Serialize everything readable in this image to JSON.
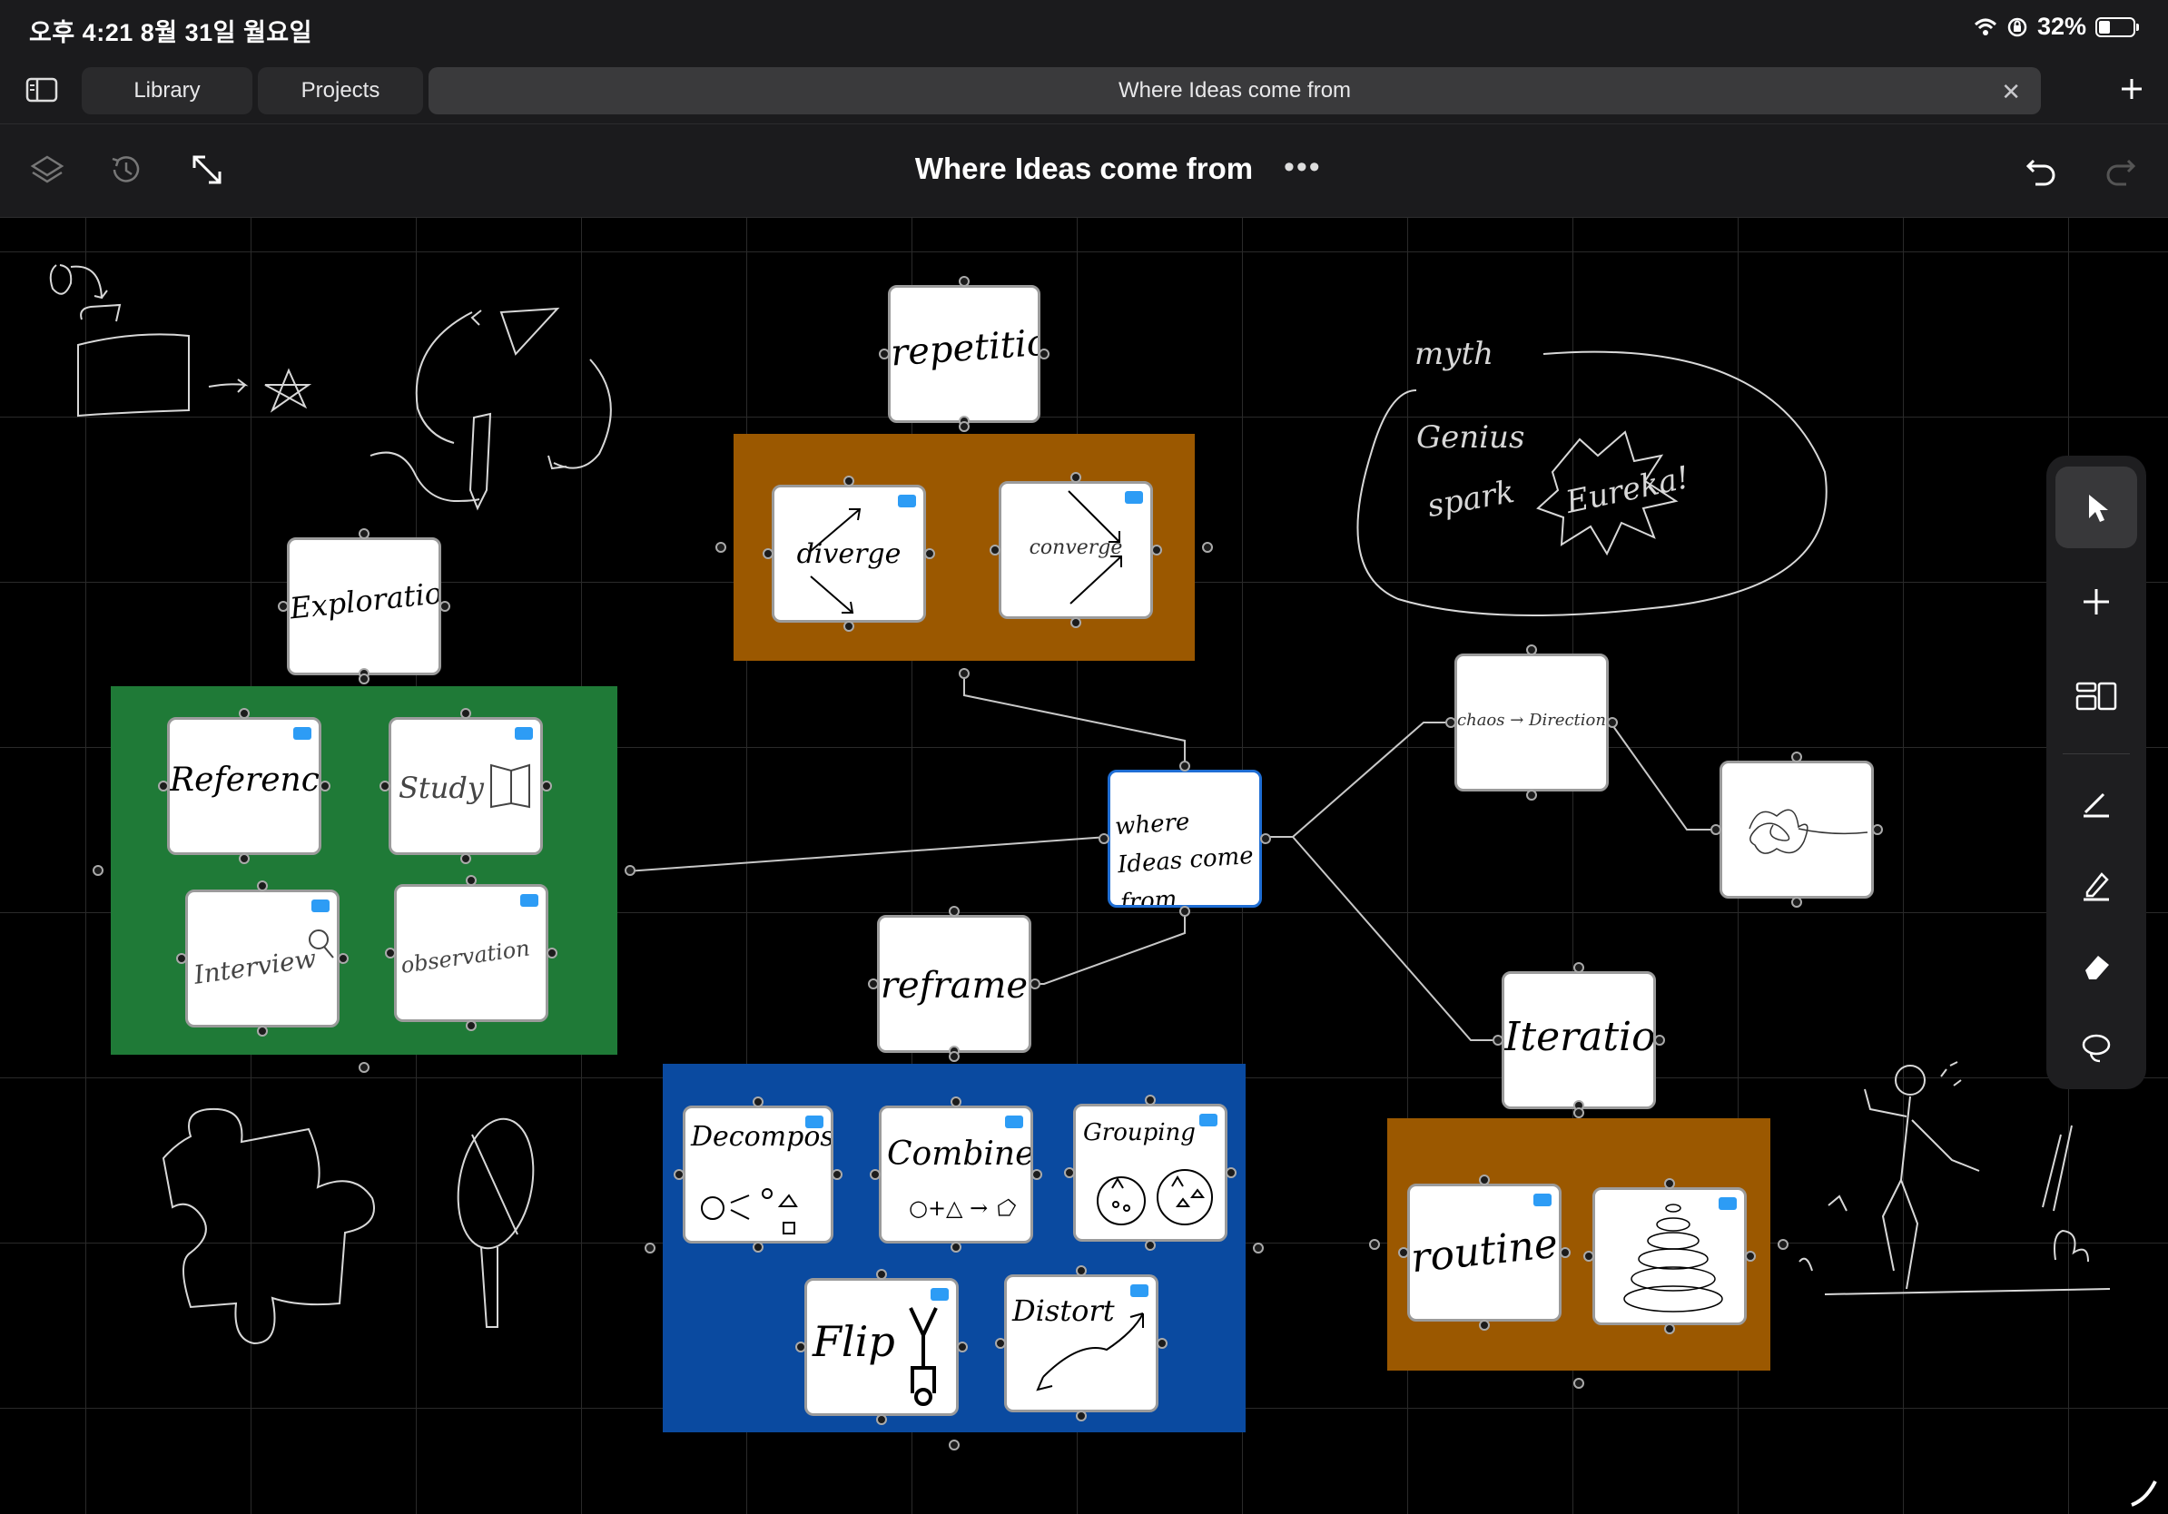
{
  "status_bar": {
    "time": "오후 4:21   8월 31일 월요일",
    "battery": "32%",
    "battery_level": 0.32
  },
  "tabs": {
    "library": "Library",
    "projects": "Projects",
    "current": "Where Ideas come from"
  },
  "toolbar": {
    "title": "Where Ideas come from"
  },
  "colors": {
    "green": "#1f7a37",
    "orange": "#9b5800",
    "blue": "#0a4aa0",
    "selection": "#1f6ed4",
    "badge": "#2d9cf5"
  },
  "cards": {
    "repetition": "repetition",
    "diverge": "diverge",
    "converge": "converge",
    "exploration": "Exploration",
    "reference": "Reference",
    "study": "Study",
    "interview": "Interview",
    "observation": "observation",
    "center": "where Ideas come from",
    "chaos": "chaos → Direction",
    "reframe": "reframe",
    "decompose": "Decompose",
    "combine": "Combine",
    "combine_formula": "○+△ → ⬠",
    "grouping": "Grouping",
    "flip": "Flip",
    "distort": "Distort",
    "iteration": "Iteration",
    "routine": "routine"
  },
  "sketch": {
    "myth": "myth",
    "genius": "Genius",
    "spark": "spark",
    "eureka": "Eureka!"
  },
  "tools": [
    "pointer-icon",
    "plus-icon",
    "layout-icon",
    "pen-icon",
    "marker-icon",
    "eraser-icon",
    "lasso-icon"
  ]
}
